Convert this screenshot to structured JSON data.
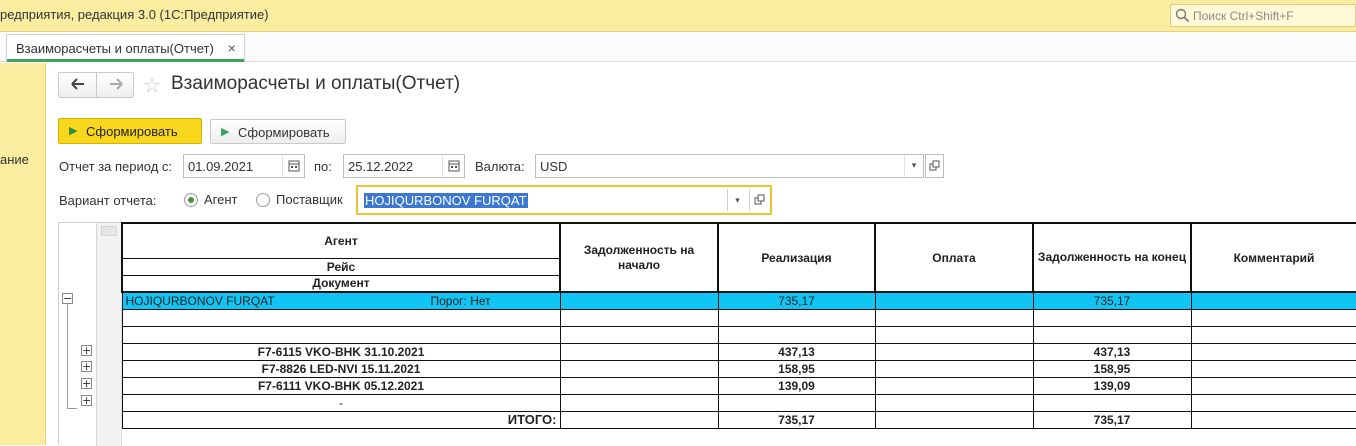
{
  "window": {
    "app_title": "редприятия, редакция 3.0  (1С:Предприятие)",
    "search_placeholder": "Поиск Ctrl+Shift+F"
  },
  "tab": {
    "label": "Взаиморасчеты и оплаты(Отчет)",
    "close": "×"
  },
  "left_panel": {
    "label": "ание"
  },
  "header": {
    "title": "Взаиморасчеты и оплаты(Отчет)",
    "back": "🡐",
    "forward": "🡒"
  },
  "toolbar": {
    "primary_label": "Сформировать",
    "secondary_label": "Сформировать"
  },
  "filters": {
    "period_label": "Отчет за период с:",
    "date_from": "01.09.2021",
    "to_label": "по:",
    "date_to": "25.12.2022",
    "currency_label": "Валюта:",
    "currency": "USD",
    "variant_label": "Вариант отчета:",
    "variant_options": [
      "Агент",
      "Поставщик"
    ],
    "variant_selected": "Агент",
    "agent": "HOJIQURBONOV FURQAT"
  },
  "report": {
    "columns": {
      "agent": "Агент",
      "reis": "Рейс",
      "document": "Документ",
      "debt_start": "Задолженность на начало",
      "sales": "Реализация",
      "payment": "Оплата",
      "debt_end": "Задолженность на конец",
      "comment": "Комментарий"
    },
    "agent_row": {
      "name": "HOJIQURBONOV FURQAT",
      "threshold": "Порог: Нет",
      "sales": "735,17",
      "debt_end": "735,17"
    },
    "flights": [
      {
        "name": "F7-6115 VKO-BHK 31.10.2021",
        "sales": "437,13",
        "debt_end": "437,13"
      },
      {
        "name": "F7-8826 LED-NVI 15.11.2021",
        "sales": "158,95",
        "debt_end": "158,95"
      },
      {
        "name": "F7-6111 VKO-BHK 05.12.2021",
        "sales": "139,09",
        "debt_end": "139,09"
      }
    ],
    "dash": "-",
    "total": {
      "label": "ИТОГО:",
      "sales": "735,17",
      "debt_end": "735,17"
    }
  }
}
